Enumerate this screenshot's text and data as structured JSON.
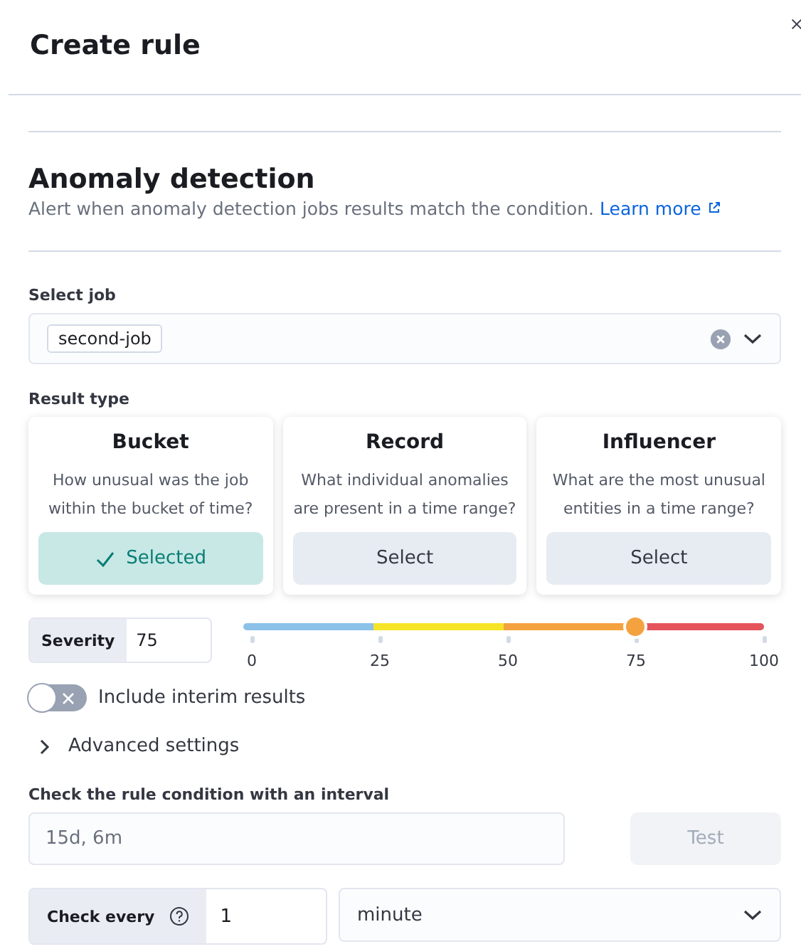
{
  "flyout": {
    "title": "Create rule"
  },
  "section": {
    "title": "Anomaly detection",
    "description": "Alert when anomaly detection jobs results match the condition.",
    "link": "Learn more"
  },
  "select_job": {
    "label": "Select job",
    "selected": [
      "second-job"
    ]
  },
  "result_type": {
    "label": "Result type",
    "options": [
      {
        "title": "Bucket",
        "description": "How unusual was the job within the bucket of time?",
        "button": "Selected",
        "selected": true
      },
      {
        "title": "Record",
        "description": "What individual anomalies are present in a time range?",
        "button": "Select",
        "selected": false
      },
      {
        "title": "Influencer",
        "description": "What are the most unusual entities in a time range?",
        "button": "Select",
        "selected": false
      }
    ]
  },
  "severity": {
    "label": "Severity",
    "value": "75",
    "level": 0.75,
    "ticks": [
      "0",
      "25",
      "50",
      "75",
      "100"
    ]
  },
  "interim": {
    "label": "Include interim results",
    "on": false
  },
  "advanced": {
    "label": "Advanced settings",
    "expanded": false
  },
  "interval": {
    "label": "Check the rule condition with an interval",
    "placeholder": "15d, 6m",
    "button": "Test",
    "disabled": true
  },
  "check_every": {
    "label": "Check every",
    "value": "1",
    "unit": "minute"
  }
}
